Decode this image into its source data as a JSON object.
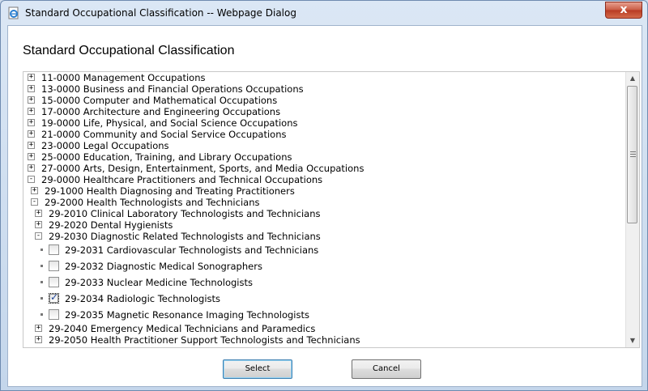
{
  "window": {
    "title": "Standard Occupational Classification -- Webpage Dialog",
    "close_glyph": "x"
  },
  "page": {
    "heading": "Standard Occupational Classification"
  },
  "tree": [
    {
      "code": "11-0000",
      "label": "Management Occupations",
      "level": 0,
      "expand": "+",
      "type": "node"
    },
    {
      "code": "13-0000",
      "label": "Business and Financial Operations Occupations",
      "level": 0,
      "expand": "+",
      "type": "node"
    },
    {
      "code": "15-0000",
      "label": "Computer and Mathematical Occupations",
      "level": 0,
      "expand": "+",
      "type": "node"
    },
    {
      "code": "17-0000",
      "label": "Architecture and Engineering Occupations",
      "level": 0,
      "expand": "+",
      "type": "node"
    },
    {
      "code": "19-0000",
      "label": "Life, Physical, and Social Science Occupations",
      "level": 0,
      "expand": "+",
      "type": "node"
    },
    {
      "code": "21-0000",
      "label": "Community and Social Service Occupations",
      "level": 0,
      "expand": "+",
      "type": "node"
    },
    {
      "code": "23-0000",
      "label": "Legal Occupations",
      "level": 0,
      "expand": "+",
      "type": "node"
    },
    {
      "code": "25-0000",
      "label": "Education, Training, and Library Occupations",
      "level": 0,
      "expand": "+",
      "type": "node"
    },
    {
      "code": "27-0000",
      "label": "Arts, Design, Entertainment, Sports, and Media Occupations",
      "level": 0,
      "expand": "+",
      "type": "node"
    },
    {
      "code": "29-0000",
      "label": "Healthcare Practitioners and Technical Occupations",
      "level": 0,
      "expand": "-",
      "type": "node"
    },
    {
      "code": "29-1000",
      "label": "Health Diagnosing and Treating Practitioners",
      "level": 1,
      "expand": "+",
      "type": "node"
    },
    {
      "code": "29-2000",
      "label": "Health Technologists and Technicians",
      "level": 1,
      "expand": "-",
      "type": "node"
    },
    {
      "code": "29-2010",
      "label": "Clinical Laboratory Technologists and Technicians",
      "level": 2,
      "expand": "+",
      "type": "node"
    },
    {
      "code": "29-2020",
      "label": "Dental Hygienists",
      "level": 2,
      "expand": "+",
      "type": "node"
    },
    {
      "code": "29-2030",
      "label": "Diagnostic Related Technologists and Technicians",
      "level": 2,
      "expand": "-",
      "type": "node"
    },
    {
      "code": "29-2031",
      "label": "Cardiovascular Technologists and Technicians",
      "level": 3,
      "type": "leaf",
      "checked": false
    },
    {
      "code": "29-2032",
      "label": "Diagnostic Medical Sonographers",
      "level": 3,
      "type": "leaf",
      "checked": false
    },
    {
      "code": "29-2033",
      "label": "Nuclear Medicine Technologists",
      "level": 3,
      "type": "leaf",
      "checked": false
    },
    {
      "code": "29-2034",
      "label": "Radiologic Technologists",
      "level": 3,
      "type": "leaf",
      "checked": true
    },
    {
      "code": "29-2035",
      "label": "Magnetic Resonance Imaging Technologists",
      "level": 3,
      "type": "leaf",
      "checked": false
    },
    {
      "code": "29-2040",
      "label": "Emergency Medical Technicians and Paramedics",
      "level": 2,
      "expand": "+",
      "type": "node"
    },
    {
      "code": "29-2050",
      "label": "Health Practitioner Support Technologists and Technicians",
      "level": 2,
      "expand": "+",
      "type": "node"
    }
  ],
  "buttons": {
    "select": "Select",
    "cancel": "Cancel"
  },
  "scrollbar": {
    "up": "▲",
    "down": "▼"
  },
  "icons": {
    "title": "ie-page-icon",
    "close": "close-icon",
    "expand": "expand-icon",
    "collapse": "collapse-icon",
    "checkbox": "checkbox-icon"
  }
}
